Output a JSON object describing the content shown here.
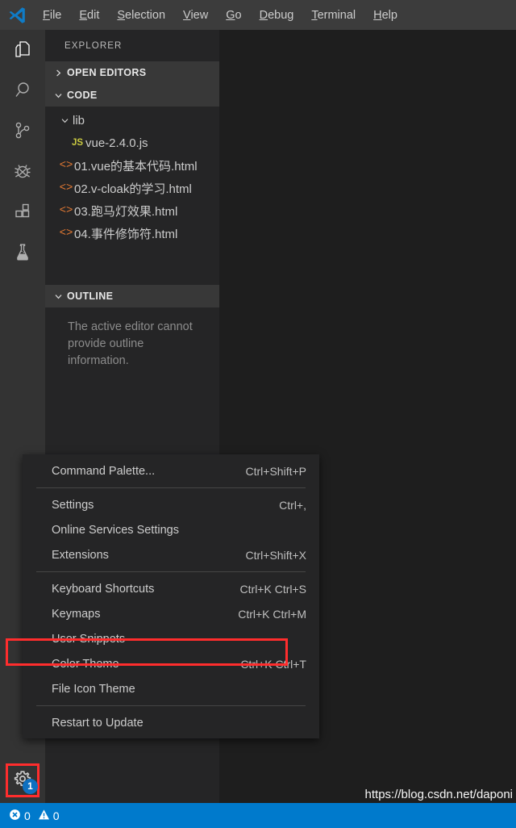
{
  "window": {
    "logo_icon": "vscode-logo-icon",
    "menus": [
      {
        "label": "File",
        "mnemonic": "F"
      },
      {
        "label": "Edit",
        "mnemonic": "E"
      },
      {
        "label": "Selection",
        "mnemonic": "S"
      },
      {
        "label": "View",
        "mnemonic": "V"
      },
      {
        "label": "Go",
        "mnemonic": "G"
      },
      {
        "label": "Debug",
        "mnemonic": "D"
      },
      {
        "label": "Terminal",
        "mnemonic": "T"
      },
      {
        "label": "Help",
        "mnemonic": "H"
      }
    ]
  },
  "activity_bar": {
    "items": [
      {
        "name": "explorer-icon",
        "title": "Explorer"
      },
      {
        "name": "search-icon",
        "title": "Search"
      },
      {
        "name": "source-control-icon",
        "title": "Source Control"
      },
      {
        "name": "debug-icon",
        "title": "Debug"
      },
      {
        "name": "extensions-icon",
        "title": "Extensions"
      },
      {
        "name": "beaker-icon",
        "title": "Test"
      }
    ],
    "manage": {
      "name": "gear-icon",
      "badge": "1"
    }
  },
  "sidebar": {
    "title": "EXPLORER",
    "sections": [
      {
        "label": "OPEN EDITORS",
        "expanded": false
      },
      {
        "label": "CODE",
        "expanded": true
      },
      {
        "label": "OUTLINE",
        "expanded": true
      }
    ],
    "tree": [
      {
        "label": "lib",
        "type": "folder",
        "indent": 1,
        "icon": "chevron-down-icon"
      },
      {
        "label": "vue-2.4.0.js",
        "type": "file",
        "indent": 2,
        "icon": "js-file-icon",
        "badge": "JS"
      },
      {
        "label": "01.vue的基本代码.html",
        "type": "file",
        "indent": 1,
        "icon": "html-file-icon",
        "badge": "<>"
      },
      {
        "label": "02.v-cloak的学习.html",
        "type": "file",
        "indent": 1,
        "icon": "html-file-icon",
        "badge": "<>"
      },
      {
        "label": "03.跑马灯效果.html",
        "type": "file",
        "indent": 1,
        "icon": "html-file-icon",
        "badge": "<>"
      },
      {
        "label": "04.事件修饰符.html",
        "type": "file",
        "indent": 1,
        "icon": "html-file-icon",
        "badge": "<>"
      }
    ],
    "outline_message": "The active editor cannot provide outline information."
  },
  "context_menu": {
    "items": [
      {
        "label": "Command Palette...",
        "shortcut": "Ctrl+Shift+P",
        "separator_after": true
      },
      {
        "label": "Settings",
        "shortcut": "Ctrl+,",
        "separator_after": false
      },
      {
        "label": "Online Services Settings",
        "shortcut": "",
        "separator_after": false
      },
      {
        "label": "Extensions",
        "shortcut": "Ctrl+Shift+X",
        "separator_after": true
      },
      {
        "label": "Keyboard Shortcuts",
        "shortcut": "Ctrl+K Ctrl+S",
        "separator_after": false
      },
      {
        "label": "Keymaps",
        "shortcut": "Ctrl+K Ctrl+M",
        "separator_after": false
      },
      {
        "label": "User Snippets",
        "shortcut": "",
        "separator_after": false,
        "highlighted": true
      },
      {
        "label": "Color Theme",
        "shortcut": "Ctrl+K Ctrl+T",
        "separator_after": false
      },
      {
        "label": "File Icon Theme",
        "shortcut": "",
        "separator_after": true
      },
      {
        "label": "Restart to Update",
        "shortcut": "",
        "separator_after": false
      }
    ]
  },
  "status_bar": {
    "errors": "0",
    "warnings": "0",
    "error_icon": "error-circle-icon",
    "warning_icon": "warning-triangle-icon",
    "watermark": "https://blog.csdn.net/daponi"
  },
  "colors": {
    "accent": "#007acc",
    "annotation": "#ff2d2d",
    "badge": "#0e70c0",
    "editor_bg": "#1e1e1e",
    "sidebar_bg": "#252526",
    "activitybar_bg": "#333333",
    "titlebar_bg": "#3c3c3c",
    "js_icon": "#cbcb41",
    "html_icon": "#e37933"
  }
}
